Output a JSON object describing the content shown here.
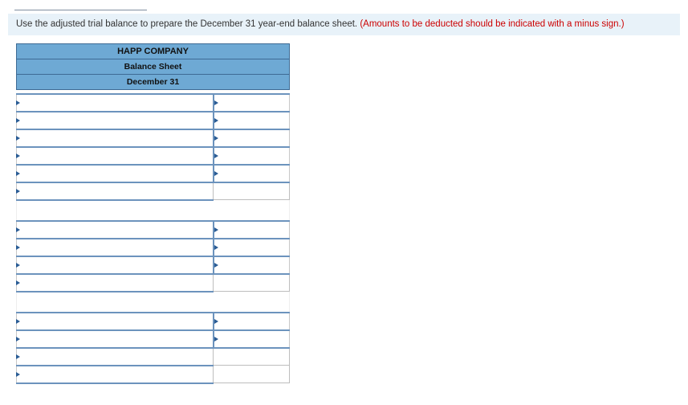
{
  "instruction": {
    "main": "Use the adjusted trial balance to prepare the December 31 year-end balance sheet. ",
    "note": "(Amounts to be deducted should be indicated with a minus sign.)"
  },
  "sheet": {
    "company": "HAPP COMPANY",
    "title": "Balance Sheet",
    "date": "December 31"
  },
  "rows": [
    {
      "kind": "entry",
      "desc": "",
      "amt": "",
      "amt_editable": true
    },
    {
      "kind": "entry",
      "desc": "",
      "amt": "",
      "amt_editable": true
    },
    {
      "kind": "entry",
      "desc": "",
      "amt": "",
      "amt_editable": true
    },
    {
      "kind": "entry",
      "desc": "",
      "amt": "",
      "amt_editable": true
    },
    {
      "kind": "entry",
      "desc": "",
      "amt": "",
      "amt_editable": true
    },
    {
      "kind": "total",
      "desc": "",
      "amt": "",
      "amt_editable": false
    },
    {
      "kind": "gap"
    },
    {
      "kind": "entry",
      "desc": "",
      "amt": "",
      "amt_editable": true
    },
    {
      "kind": "entry",
      "desc": "",
      "amt": "",
      "amt_editable": true
    },
    {
      "kind": "entry",
      "desc": "",
      "amt": "",
      "amt_editable": true
    },
    {
      "kind": "total",
      "desc": "",
      "amt": "",
      "amt_editable": false
    },
    {
      "kind": "gap"
    },
    {
      "kind": "entry",
      "desc": "",
      "amt": "",
      "amt_editable": true
    },
    {
      "kind": "entry",
      "desc": "",
      "amt": "",
      "amt_editable": true
    },
    {
      "kind": "total",
      "desc": "",
      "amt": "",
      "amt_editable": false
    },
    {
      "kind": "total",
      "desc": "",
      "amt": "",
      "amt_editable": false
    }
  ]
}
